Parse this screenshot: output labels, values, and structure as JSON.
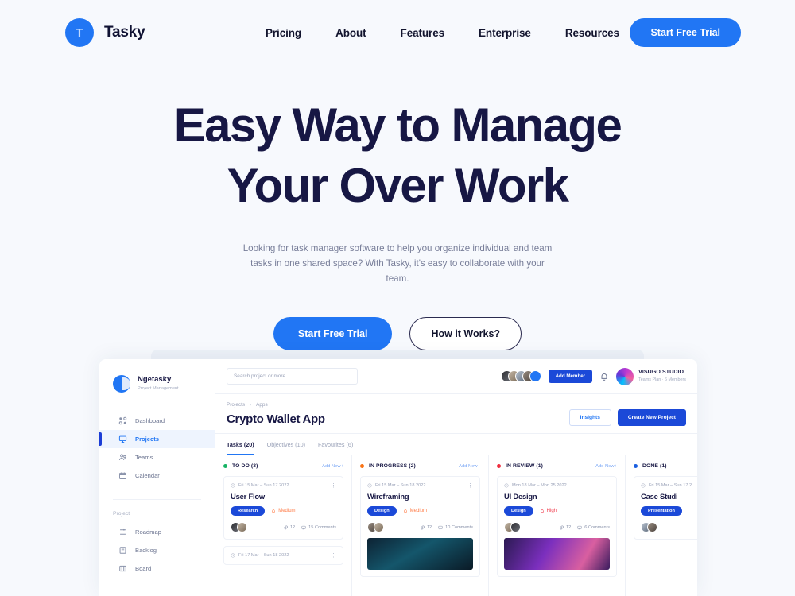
{
  "header": {
    "brand": {
      "mark": "T",
      "name": "Tasky"
    },
    "nav": [
      {
        "label": "Pricing"
      },
      {
        "label": "About"
      },
      {
        "label": "Features"
      },
      {
        "label": "Enterprise"
      },
      {
        "label": "Resources"
      }
    ],
    "cta_label": "Start Free Trial"
  },
  "hero": {
    "title_line1": "Easy Way to Manage",
    "title_line2": "Your Over Work",
    "subtitle": "Looking for task manager software to help you organize individual and team tasks in one shared space? With Tasky, it's easy to collaborate with your team.",
    "primary_cta": "Start Free Trial",
    "secondary_cta": "How it Works?"
  },
  "colors": {
    "accent_blue": "#2176f4",
    "deep_blue": "#1b49d8",
    "heading_navy": "#171744",
    "page_bg": "#f7f9fd",
    "todo_dot": "#16b364",
    "in_progress_dot": "#f97316",
    "in_review_dot": "#ef2e3f",
    "done_dot": "#1b5fe0",
    "priority_medium": "#ff7a45",
    "priority_high": "#f0384a"
  },
  "app": {
    "workspace": {
      "name": "Ngetasky",
      "subtitle": "Project Management"
    },
    "sidebar": {
      "items": [
        {
          "label": "Dashboard",
          "icon": "dashboard-icon",
          "active": false
        },
        {
          "label": "Projects",
          "icon": "projects-icon",
          "active": true
        },
        {
          "label": "Teams",
          "icon": "teams-icon",
          "active": false
        },
        {
          "label": "Calendar",
          "icon": "calendar-icon",
          "active": false
        }
      ],
      "group_label": "Project",
      "project_items": [
        {
          "label": "Roadmap",
          "icon": "roadmap-icon"
        },
        {
          "label": "Backlog",
          "icon": "backlog-icon"
        },
        {
          "label": "Board",
          "icon": "board-icon"
        }
      ]
    },
    "topbar": {
      "search_placeholder": "Search project or more ...",
      "add_member_label": "Add Member",
      "bell_icon": "bell-icon",
      "org_name": "VISUGO STUDIO",
      "org_sub": "Teams Plan · 6 Members"
    },
    "breadcrumb": {
      "root": "Projects",
      "sep": "›",
      "current": "Apps"
    },
    "project_title": "Crypto Wallet App",
    "actions": {
      "insights_label": "Insights",
      "create_label": "Create New Project"
    },
    "tabs": [
      {
        "label": "Tasks (20)",
        "active": true
      },
      {
        "label": "Objectives (10)",
        "active": false
      },
      {
        "label": "Favourites (6)",
        "active": false
      }
    ],
    "add_new_label": "Add New+",
    "columns": [
      {
        "name": "TO DO (3)",
        "dot": "#16b364",
        "cards": [
          {
            "date": "Fri 15 Mar – Sun 17 2022",
            "title": "User Flow",
            "tag": "Research",
            "priority": "Medium",
            "priority_level": "medium",
            "attachments": "12",
            "comments": "15 Comments",
            "image": "none"
          },
          {
            "date": "Fri 17 Mar – Sun 18 2022",
            "title": "",
            "tag": "",
            "priority": "",
            "priority_level": "medium",
            "attachments": "",
            "comments": "",
            "image": "none"
          }
        ]
      },
      {
        "name": "IN PROGRESS (2)",
        "dot": "#f97316",
        "cards": [
          {
            "date": "Fri 15 Mar – Sun 18 2022",
            "title": "Wireframing",
            "tag": "Design",
            "priority": "Medium",
            "priority_level": "medium",
            "attachments": "12",
            "comments": "10 Comments",
            "image": "wire"
          }
        ]
      },
      {
        "name": "IN REVIEW (1)",
        "dot": "#ef2e3f",
        "cards": [
          {
            "date": "Mon 18 Mar – Mon 25 2022",
            "title": "UI Design",
            "tag": "Design",
            "priority": "High",
            "priority_level": "high",
            "attachments": "12",
            "comments": "6 Comments",
            "image": "ui"
          }
        ]
      },
      {
        "name": "DONE (1)",
        "dot": "#1b5fe0",
        "cards": [
          {
            "date": "Fri 15 Mar – Sun 17 2",
            "title": "Case Studi",
            "tag": "Presentation",
            "priority": "",
            "priority_level": "medium",
            "attachments": "",
            "comments": "",
            "image": "none"
          }
        ]
      }
    ]
  }
}
